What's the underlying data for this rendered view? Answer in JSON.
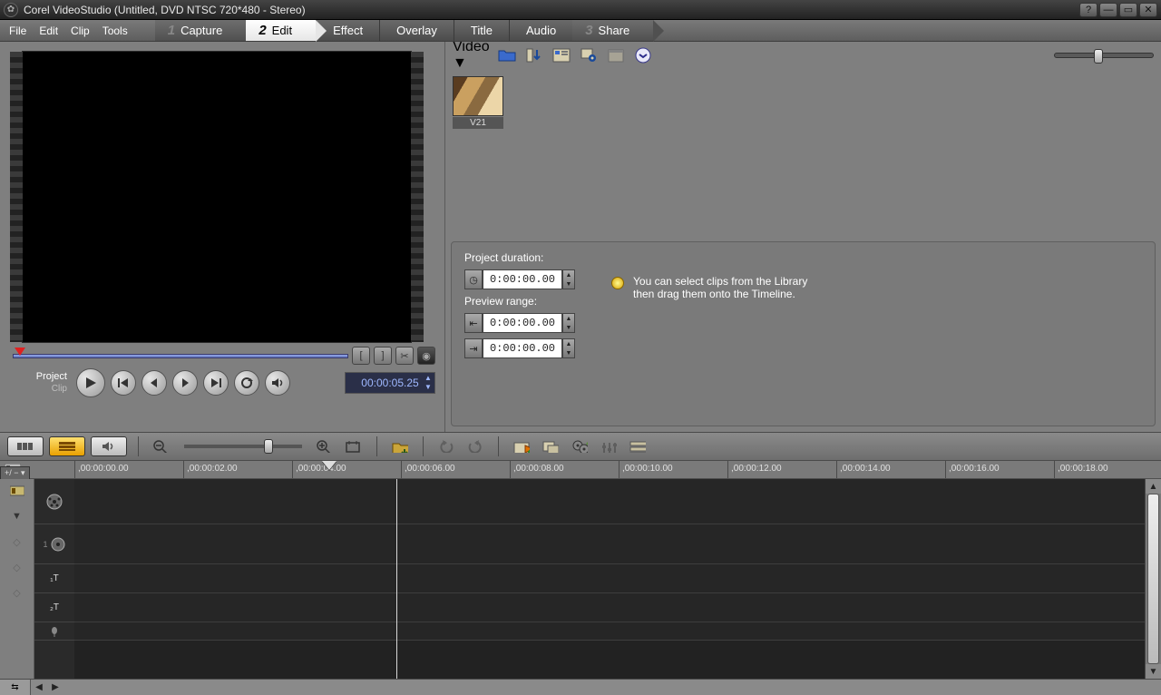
{
  "title": "Corel VideoStudio (Untitled, DVD NTSC 720*480 - Stereo)",
  "menus": [
    "File",
    "Edit",
    "Clip",
    "Tools"
  ],
  "steps": {
    "s1_num": "1",
    "s1_label": "Capture",
    "s2_num": "2",
    "s2_label": "Edit",
    "effect": "Effect",
    "overlay": "Overlay",
    "title": "Title",
    "audio": "Audio",
    "s3_num": "3",
    "s3_label": "Share"
  },
  "preview": {
    "project_label": "Project",
    "clip_label": "Clip",
    "timecode": "00:00:05.25"
  },
  "library": {
    "gallery_selected": "Video",
    "clip_label": "V21"
  },
  "options": {
    "project_duration_label": "Project duration:",
    "preview_range_label": "Preview range:",
    "tc_zero": "0:00:00.00",
    "hint_line1": "You can select clips from the Library",
    "hint_line2": "then drag them onto the Timeline."
  },
  "ruler": {
    "ticks": [
      ",00:00:00.00",
      ",00:00:02.00",
      ",00:00:04.00",
      ",00:00:06.00",
      ",00:00:08.00",
      ",00:00:10.00",
      ",00:00:12.00",
      ",00:00:14.00",
      ",00:00:16.00",
      ",00:00:18.00"
    ]
  },
  "track_heads": {
    "t3": "₁T",
    "t4": "₂T"
  },
  "plusminus": "+/ − ▾"
}
